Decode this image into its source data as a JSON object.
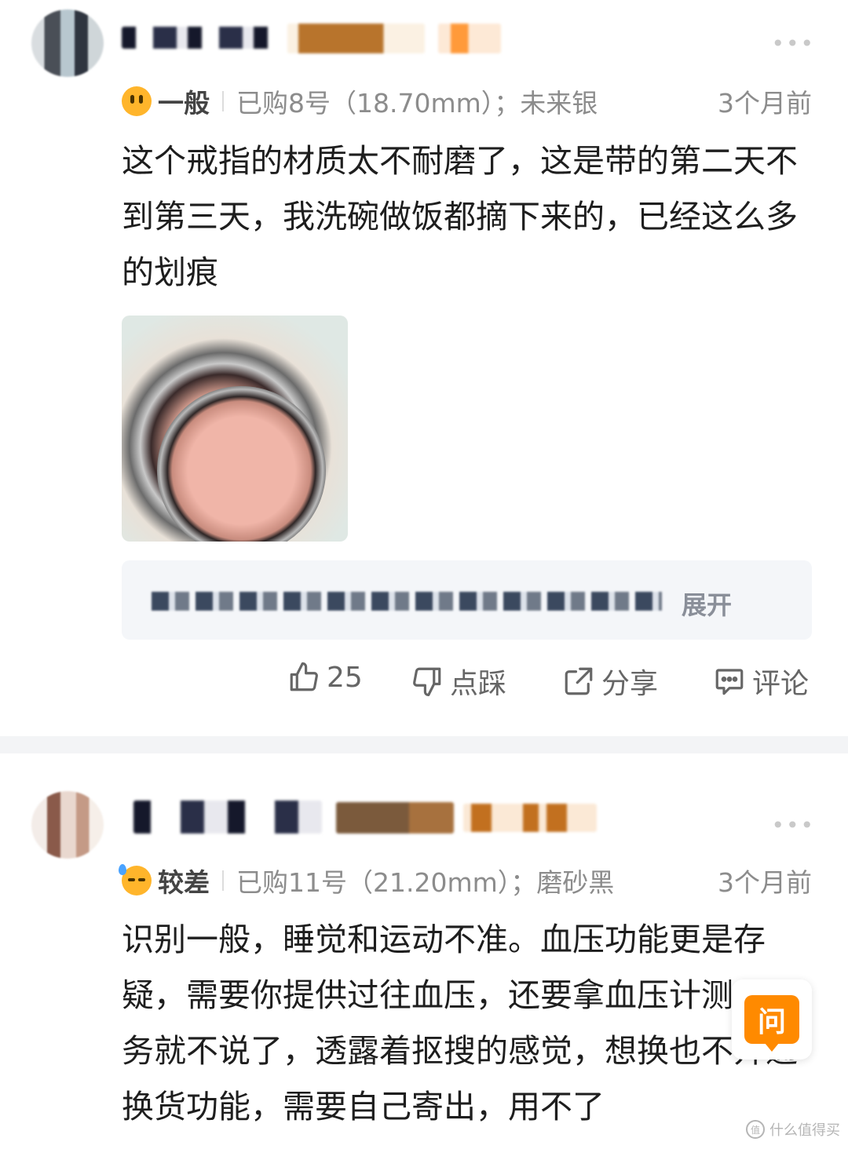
{
  "reviews": [
    {
      "rating": "一般",
      "spec": "已购8号（18.70mm）；未来银",
      "time": "3个月前",
      "content": "这个戒指的材质太不耐磨了，这是带的第二天不到第三天，我洗碗做饭都摘下来的，已经这么多的划痕",
      "reply_expand_label": "展开",
      "actions": {
        "like_count": "25",
        "dislike_label": "点踩",
        "share_label": "分享",
        "comment_label": "评论"
      }
    },
    {
      "rating": "较差",
      "spec": "已购11号（21.20mm）；磨砂黑",
      "time": "3个月前",
      "content": "识别一般，睡觉和运动不准。血压功能更是存疑，需要你提供过往血压，还要拿血压计测，服务就不说了，透露着抠搜的感觉，想换也不开通换货功能，需要自己寄出，用不了"
    }
  ],
  "ask_button_label": "问",
  "watermark": "什么值得买",
  "colors": {
    "accent": "#ff8a00",
    "meta_gray": "#8c8c8c",
    "divider": "#f3f4f6"
  }
}
